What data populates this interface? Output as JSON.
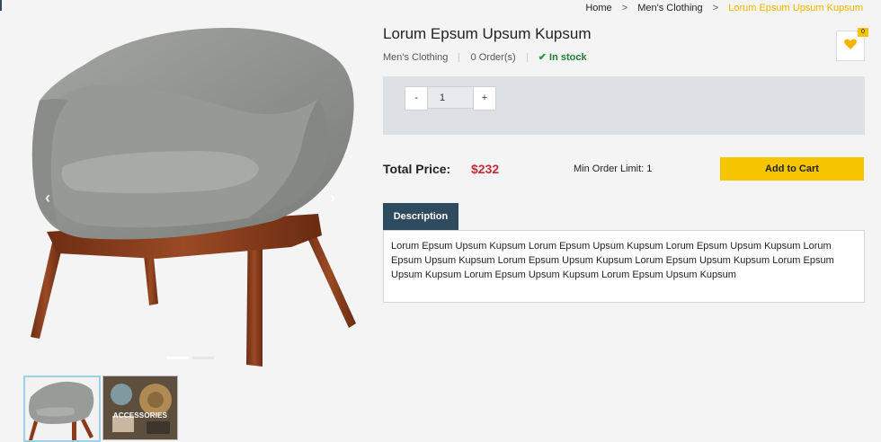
{
  "breadcrumb": {
    "items": [
      "Home",
      "Men's Clothing"
    ],
    "current": "Lorum Epsum Upsum Kupsum",
    "separator": ">"
  },
  "gallery": {
    "prev_arrow": "‹",
    "next_arrow": "›",
    "thumbnails": [
      {
        "label": ""
      },
      {
        "label": "ACCESSORIES"
      }
    ]
  },
  "product": {
    "title": "Lorum Epsum Upsum Kupsum",
    "category": "Men's Clothing",
    "orders": "0 Order(s)",
    "stock_status": "In stock",
    "wishlist_count": "0"
  },
  "quantity": {
    "minus_label": "-",
    "value": "1",
    "plus_label": "+"
  },
  "pricing": {
    "total_label": "Total Price:",
    "price": "$232",
    "min_order": "Min Order Limit: 1",
    "add_to_cart": "Add to Cart"
  },
  "tabs": {
    "description_label": "Description",
    "description_text": "Lorum Epsum Upsum Kupsum Lorum Epsum Upsum Kupsum Lorum Epsum Upsum Kupsum Lorum Epsum Upsum Kupsum Lorum Epsum Upsum Kupsum Lorum Epsum Upsum Kupsum Lorum Epsum Upsum Kupsum Lorum Epsum Upsum Kupsum Lorum Epsum Upsum Kupsum"
  },
  "colors": {
    "accent": "#f7c400",
    "dark": "#2f4b5f",
    "price": "#c42b35",
    "stock": "#1d7a37",
    "breadcrumb_current": "#f5b400"
  },
  "icons": [
    "chevron-left-icon",
    "chevron-right-icon",
    "heart-icon",
    "check-icon"
  ]
}
